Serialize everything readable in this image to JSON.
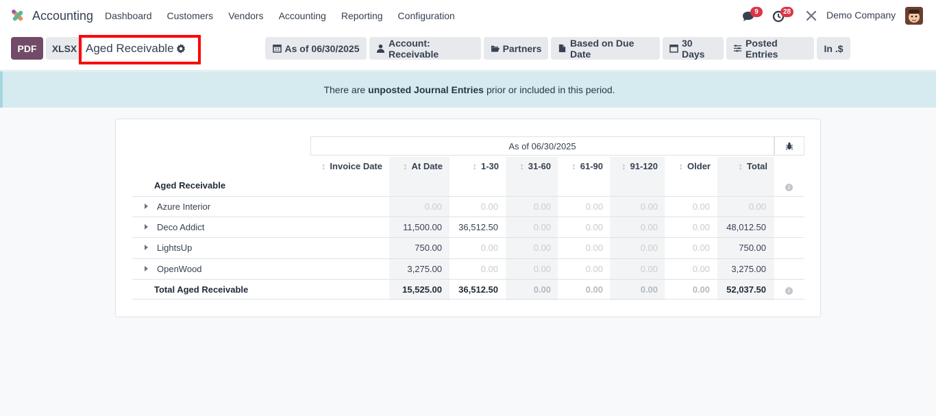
{
  "navbar": {
    "app_name": "Accounting",
    "menu": [
      "Dashboard",
      "Customers",
      "Vendors",
      "Accounting",
      "Reporting",
      "Configuration"
    ],
    "messages_count": "9",
    "activities_count": "28",
    "company": "Demo Company"
  },
  "toolbar": {
    "pdf_label": "PDF",
    "xlsx_label": "XLSX",
    "report_title": "Aged Receivable",
    "filters": [
      "As of 06/30/2025",
      "Account: Receivable",
      "Partners",
      "Based on Due Date",
      "30 Days",
      "Posted Entries",
      "In .$"
    ]
  },
  "alert": {
    "prefix": "There are",
    "bold": "unposted Journal Entries",
    "suffix": "prior or included in this period."
  },
  "report": {
    "period_header": "As of 06/30/2025",
    "columns": [
      "Invoice Date",
      "At Date",
      "1-30",
      "31-60",
      "61-90",
      "91-120",
      "Older",
      "Total"
    ],
    "section_title": "Aged Receivable",
    "rows": [
      {
        "name": "Azure Interior",
        "values": [
          "0.00",
          "0.00",
          "0.00",
          "0.00",
          "0.00",
          "0.00",
          "0.00"
        ]
      },
      {
        "name": "Deco Addict",
        "values": [
          "11,500.00",
          "36,512.50",
          "0.00",
          "0.00",
          "0.00",
          "0.00",
          "48,012.50"
        ]
      },
      {
        "name": "LightsUp",
        "values": [
          "750.00",
          "0.00",
          "0.00",
          "0.00",
          "0.00",
          "0.00",
          "750.00"
        ]
      },
      {
        "name": "OpenWood",
        "values": [
          "3,275.00",
          "0.00",
          "0.00",
          "0.00",
          "0.00",
          "0.00",
          "3,275.00"
        ]
      }
    ],
    "total": {
      "name": "Total Aged Receivable",
      "values": [
        "15,525.00",
        "36,512.50",
        "0.00",
        "0.00",
        "0.00",
        "0.00",
        "52,037.50"
      ]
    }
  }
}
